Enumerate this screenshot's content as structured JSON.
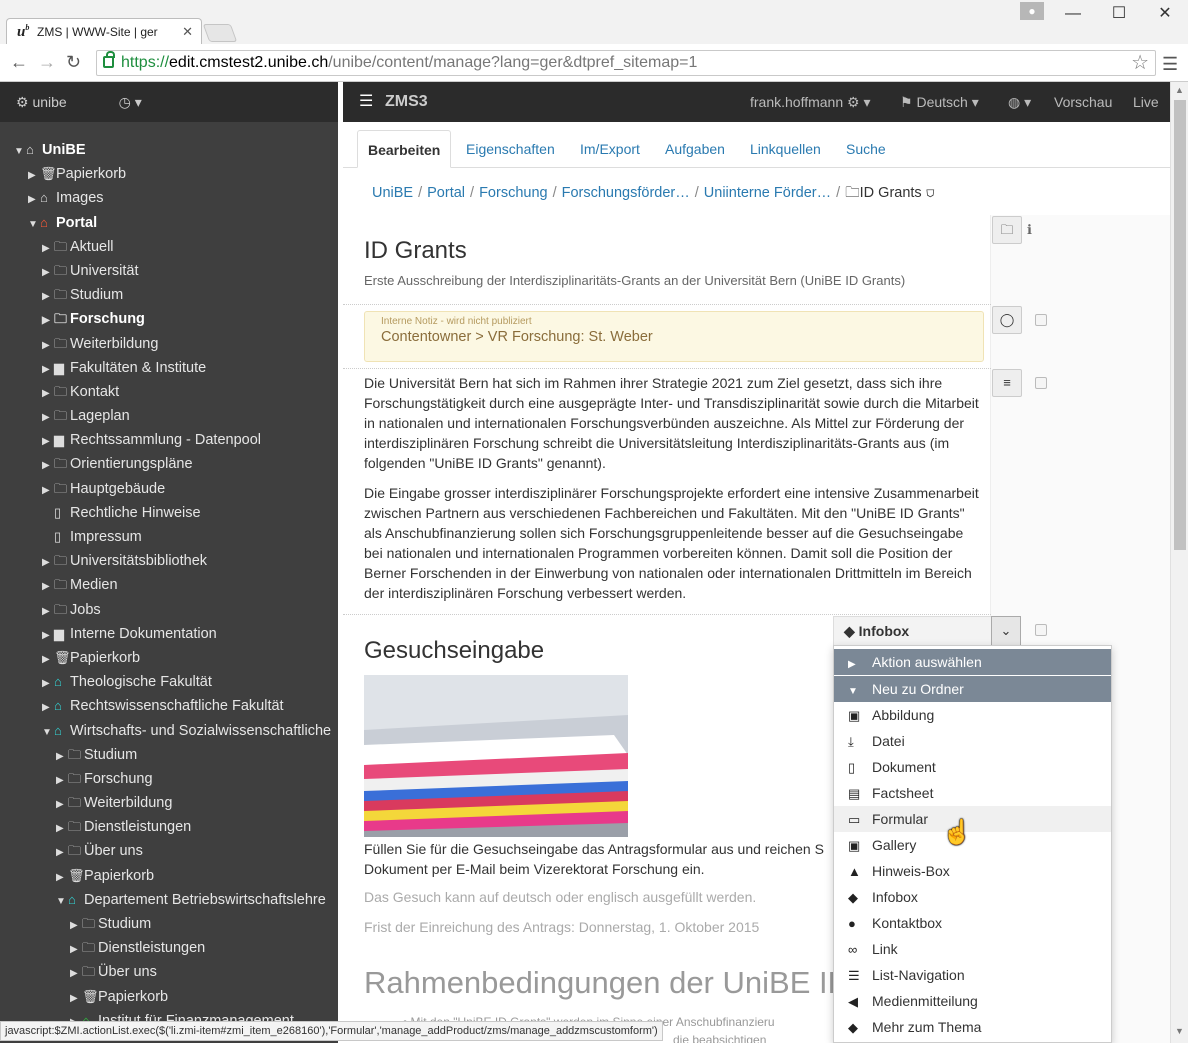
{
  "browser": {
    "tab_title": "ZMS | WWW-Site | ger",
    "tab_favicon": "u",
    "tab_favicon_sup": "b",
    "url_scheme": "https://",
    "url_host": "edit.cmstest2.unibe.ch",
    "url_path": "/unibe/content/manage?lang=ger&dtpref_sitemap=1"
  },
  "sidebar": {
    "site": "unibe",
    "tree": [
      {
        "label": "UniBE",
        "depth": 0,
        "caret": "down",
        "icon": "home",
        "bold": true
      },
      {
        "label": "Papierkorb",
        "depth": 1,
        "caret": "right",
        "icon": "trash"
      },
      {
        "label": "Images",
        "depth": 1,
        "caret": "right",
        "icon": "home"
      },
      {
        "label": "Portal",
        "depth": 1,
        "caret": "down",
        "icon": "home-red",
        "bold": true
      },
      {
        "label": "Aktuell",
        "depth": 2,
        "caret": "right",
        "icon": "folder"
      },
      {
        "label": "Universität",
        "depth": 2,
        "caret": "right",
        "icon": "folder"
      },
      {
        "label": "Studium",
        "depth": 2,
        "caret": "right",
        "icon": "folder"
      },
      {
        "label": "Forschung",
        "depth": 2,
        "caret": "right",
        "icon": "folder",
        "bold": true
      },
      {
        "label": "Weiterbildung",
        "depth": 2,
        "caret": "right",
        "icon": "folder"
      },
      {
        "label": "Fakultäten & Institute",
        "depth": 2,
        "caret": "right",
        "icon": "briefcase"
      },
      {
        "label": "Kontakt",
        "depth": 2,
        "caret": "right",
        "icon": "folder"
      },
      {
        "label": "Lageplan",
        "depth": 2,
        "caret": "right",
        "icon": "folder"
      },
      {
        "label": "Rechtssammlung - Datenpool",
        "depth": 2,
        "caret": "right",
        "icon": "briefcase"
      },
      {
        "label": "Orientierungspläne",
        "depth": 2,
        "caret": "right",
        "icon": "folder"
      },
      {
        "label": "Hauptgebäude",
        "depth": 2,
        "caret": "right",
        "icon": "folder"
      },
      {
        "label": "Rechtliche Hinweise",
        "depth": 2,
        "caret": "",
        "icon": "doc"
      },
      {
        "label": "Impressum",
        "depth": 2,
        "caret": "",
        "icon": "doc"
      },
      {
        "label": "Universitätsbibliothek",
        "depth": 2,
        "caret": "right",
        "icon": "folder"
      },
      {
        "label": "Medien",
        "depth": 2,
        "caret": "right",
        "icon": "folder"
      },
      {
        "label": "Jobs",
        "depth": 2,
        "caret": "right",
        "icon": "folder"
      },
      {
        "label": "Interne Dokumentation",
        "depth": 2,
        "caret": "right",
        "icon": "briefcase"
      },
      {
        "label": "Papierkorb",
        "depth": 2,
        "caret": "right",
        "icon": "trash"
      },
      {
        "label": "Theologische Fakultät",
        "depth": 2,
        "caret": "right",
        "icon": "home-teal"
      },
      {
        "label": "Rechtswissenschaftliche Fakultät",
        "depth": 2,
        "caret": "right",
        "icon": "home-teal"
      },
      {
        "label": "Wirtschafts- und Sozialwissenschaftliche",
        "depth": 2,
        "caret": "down",
        "icon": "home-teal"
      },
      {
        "label": "Studium",
        "depth": 3,
        "caret": "right",
        "icon": "folder"
      },
      {
        "label": "Forschung",
        "depth": 3,
        "caret": "right",
        "icon": "folder"
      },
      {
        "label": "Weiterbildung",
        "depth": 3,
        "caret": "right",
        "icon": "folder"
      },
      {
        "label": "Dienstleistungen",
        "depth": 3,
        "caret": "right",
        "icon": "folder"
      },
      {
        "label": "Über uns",
        "depth": 3,
        "caret": "right",
        "icon": "folder"
      },
      {
        "label": "Papierkorb",
        "depth": 3,
        "caret": "right",
        "icon": "trash"
      },
      {
        "label": "Departement Betriebswirtschaftslehre",
        "depth": 3,
        "caret": "down",
        "icon": "home-teal"
      },
      {
        "label": "Studium",
        "depth": 4,
        "caret": "right",
        "icon": "folder"
      },
      {
        "label": "Dienstleistungen",
        "depth": 4,
        "caret": "right",
        "icon": "folder"
      },
      {
        "label": "Über uns",
        "depth": 4,
        "caret": "right",
        "icon": "folder"
      },
      {
        "label": "Papierkorb",
        "depth": 4,
        "caret": "right",
        "icon": "trash"
      },
      {
        "label": "Institut für Finanzmanagement",
        "depth": 4,
        "caret": "right",
        "icon": "home-green"
      }
    ]
  },
  "topnav": {
    "brand": "ZMS3",
    "user": "frank.hoffmann",
    "language": "Deutsch",
    "preview": "Vorschau",
    "live": "Live"
  },
  "tabs": [
    "Bearbeiten",
    "Eigenschaften",
    "Im/Export",
    "Aufgaben",
    "Linkquellen",
    "Suche"
  ],
  "breadcrumb": [
    "UniBE",
    "Portal",
    "Forschung",
    "Forschungsförder…",
    "Uniinterne Förder…"
  ],
  "breadcrumb_current": "ID Grants",
  "page": {
    "title": "ID Grants",
    "subtitle": "Erste Ausschreibung der Interdisziplinaritäts-Grants an der Universität Bern (UniBE ID Grants)",
    "note_label": "Interne Notiz - wird nicht publiziert",
    "note_text": "Contentowner > VR Forschung: St. Weber",
    "para1": "Die Universität Bern hat sich im Rahmen ihrer Strategie 2021 zum Ziel gesetzt, dass sich ihre Forschungstätigkeit durch eine ausgeprägte Inter- und Transdisziplinarität sowie durch die Mitarbeit in nationalen und internationalen Forschungsverbünden auszeichne. Als Mittel zur Förderung der interdisziplinären Forschung schreibt die Universitätsleitung Interdisziplinaritäts-Grants aus (im folgenden \"UniBE ID Grants\" genannt).",
    "para2": "Die Eingabe grosser interdisziplinärer Forschungsprojekte erfordert eine intensive Zusammenarbeit zwischen Partnern aus verschiedenen Fachbereichen und Fakultäten. Mit den \"UniBE ID Grants\" als Anschubfinanzierung sollen sich Forschungsgruppenleitende besser auf die Gesuchseingabe bei nationalen und internationalen Programmen vorbereiten können. Damit soll die Position der Berner Forschenden in der Einwerbung von nationalen oder internationalen Drittmitteln im Bereich der interdisziplinären Forschung verbessert werden.",
    "section_title": "Gesuchseingabe",
    "section_text": "Füllen Sie für die Gesuchseingabe das Antragsformular aus und reichen Sie das Dokument per E-Mail beim Vizerektorat Forschung ein.",
    "section_text_visible_1": "Füllen Sie für die Gesuchseingabe das Antragsformular aus und reichen S",
    "section_text_visible_2": "Dokument per E-Mail beim Vizerektorat Forschung ein.",
    "grey1": "Das Gesuch kann auf deutsch oder englisch ausgefüllt werden.",
    "grey2": "Frist der Einreichung des Antrags: Donnerstag, 1. Oktober 2015",
    "big_heading": "Rahmenbedingungen der UniBE ID",
    "bullet_line1": "Mit den \"UniBE ID Grants\" werden im Sinne einer Anschubfinanzieru",
    "bullet_line2": "die beabsichtigen"
  },
  "dropdown": {
    "button_label": "Infobox",
    "header_action": "Aktion auswählen",
    "header_new": "Neu zu Ordner",
    "items": [
      {
        "label": "Abbildung",
        "icon": "image-icon",
        "glyph": "▣"
      },
      {
        "label": "Datei",
        "icon": "download-icon",
        "glyph": "⤓"
      },
      {
        "label": "Dokument",
        "icon": "document-icon",
        "glyph": "▯"
      },
      {
        "label": "Factsheet",
        "icon": "factsheet-icon",
        "glyph": "▤"
      },
      {
        "label": "Formular",
        "icon": "form-icon",
        "glyph": "▭"
      },
      {
        "label": "Gallery",
        "icon": "gallery-icon",
        "glyph": "▣"
      },
      {
        "label": "Hinweis-Box",
        "icon": "warning-icon",
        "glyph": "▲"
      },
      {
        "label": "Infobox",
        "icon": "tag-icon",
        "glyph": "◆"
      },
      {
        "label": "Kontaktbox",
        "icon": "user-icon",
        "glyph": "●"
      },
      {
        "label": "Link",
        "icon": "link-icon",
        "glyph": "∞"
      },
      {
        "label": "List-Navigation",
        "icon": "list-icon",
        "glyph": "☰"
      },
      {
        "label": "Medienmitteilung",
        "icon": "megaphone-icon",
        "glyph": "◀"
      },
      {
        "label": "Mehr zum Thema",
        "icon": "tags-icon",
        "glyph": "◆"
      }
    ]
  },
  "status_bar": "javascript:$ZMI.actionList.exec($('li.zmi-item#zmi_item_e268160'),'Formular','manage_addProduct/zms/manage_addzmscustomform')"
}
